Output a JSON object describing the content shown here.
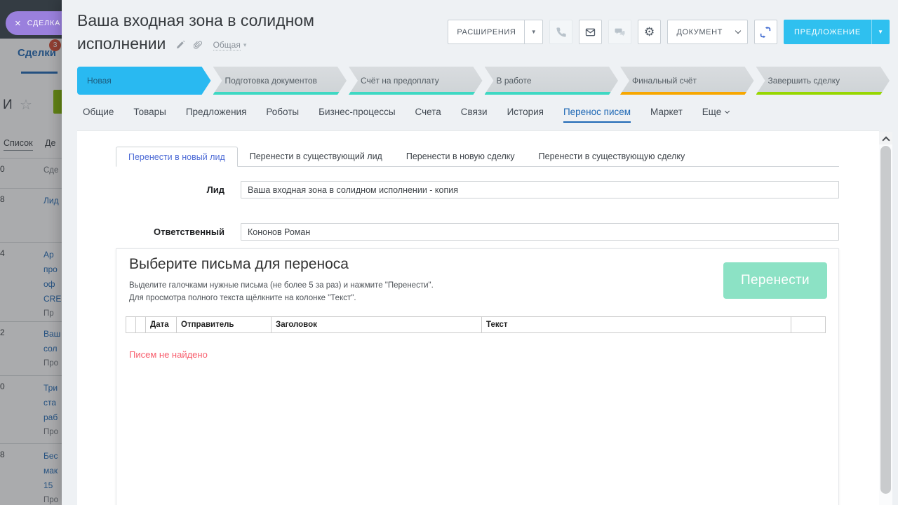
{
  "colors": {
    "accent_blue": "#29b9f1",
    "primary_button": "#2fc0ef",
    "active_tab_blue": "#1e68b5",
    "subtab_active_blue": "#4d6bd6",
    "transfer_button_mint": "#8ce2c5",
    "error_red": "#f75e6d",
    "stage_teal": "#3ed8c3",
    "stage_orange": "#f7a700",
    "stage_green": "#97d700",
    "slider_pill_purple": "#9a80dd",
    "badge_red": "#d44a31"
  },
  "background_page": {
    "slider_tab": {
      "close_icon": "×",
      "label": "СДЕЛКА"
    },
    "nav": {
      "label": "Сделки",
      "badge": "3"
    },
    "title_fragment": "И",
    "star_icon": "☆",
    "view_tabs": {
      "active": "Список",
      "next_fragment": "Де"
    },
    "list_rows": [
      {
        "num": "0",
        "link_lines": [],
        "plain_lines": [
          "Сде"
        ]
      },
      {
        "num": "8",
        "link_lines": [
          "Лид"
        ],
        "plain_lines": []
      },
      {
        "num": "4",
        "link_lines": [
          "Ар",
          "про",
          "оф",
          "CRE"
        ],
        "plain_lines": [
          "Пр"
        ]
      },
      {
        "num": "2",
        "link_lines": [
          "Ваш",
          "сол"
        ],
        "plain_lines": [
          "Про"
        ]
      },
      {
        "num": "0",
        "link_lines": [
          "Три",
          "ста",
          "раб"
        ],
        "plain_lines": [
          "Про"
        ]
      },
      {
        "num": "8",
        "link_lines": [
          "Бес",
          "мак",
          "15"
        ],
        "plain_lines": [
          "Про"
        ]
      }
    ]
  },
  "header": {
    "title": "Ваша входная зона в солидном исполнении",
    "category": "Общая",
    "toolbar": {
      "extensions": "РАСШИРЕНИЯ",
      "document": "ДОКУМЕНТ",
      "proposal": "ПРЕДЛОЖЕНИЕ"
    }
  },
  "stages": [
    {
      "label": "Новая",
      "name": "stage-new",
      "active": true
    },
    {
      "label": "Подготовка документов",
      "name": "stage-docs-preparation",
      "underline_color": "#3ed8c3"
    },
    {
      "label": "Счёт на предоплату",
      "name": "stage-prepayment-invoice",
      "underline_color": "#3ed8c3"
    },
    {
      "label": "В работе",
      "name": "stage-in-progress",
      "underline_color": "#3ed8c3"
    },
    {
      "label": "Финальный счёт",
      "name": "stage-final-invoice",
      "underline_color": "#f7a700"
    },
    {
      "label": "Завершить сделку",
      "name": "stage-close-deal",
      "underline_color": "#97d700"
    }
  ],
  "tabs": [
    {
      "label": "Общие",
      "name": "tab-general"
    },
    {
      "label": "Товары",
      "name": "tab-products"
    },
    {
      "label": "Предложения",
      "name": "tab-quotes"
    },
    {
      "label": "Роботы",
      "name": "tab-robots"
    },
    {
      "label": "Бизнес-процессы",
      "name": "tab-business-processes"
    },
    {
      "label": "Счета",
      "name": "tab-invoices"
    },
    {
      "label": "Связи",
      "name": "tab-links"
    },
    {
      "label": "История",
      "name": "tab-history"
    },
    {
      "label": "Перенос писем",
      "name": "tab-mail-transfer",
      "active": true
    },
    {
      "label": "Маркет",
      "name": "tab-market"
    },
    {
      "label": "Еще",
      "name": "tab-more",
      "dropdown": true
    }
  ],
  "mail_transfer": {
    "subtabs": [
      {
        "label": "Перенести в новый лид",
        "name": "subtab-new-lead",
        "active": true
      },
      {
        "label": "Перенести в существующий лид",
        "name": "subtab-existing-lead"
      },
      {
        "label": "Перенести в новую сделку",
        "name": "subtab-new-deal"
      },
      {
        "label": "Перенести в существующую сделку",
        "name": "subtab-existing-deal"
      }
    ],
    "fields": [
      {
        "label": "Лид",
        "value": "Ваша входная зона в солидном исполнении - копия"
      },
      {
        "label": "Ответственный",
        "value": "Кононов Роман"
      }
    ],
    "panel": {
      "heading": "Выберите письма для переноса",
      "hint_line1": "Выделите галочками нужные письма (не более 5 за раз) и нажмите \"Перенести\".",
      "hint_line2": "Для просмотра полного текста щёлкните на колонке \"Текст\".",
      "transfer_button": "Перенести",
      "columns": [
        "",
        "",
        "Дата",
        "Отправитель",
        "Заголовок",
        "Текст",
        ""
      ],
      "empty_message": "Писем не найдено"
    }
  }
}
